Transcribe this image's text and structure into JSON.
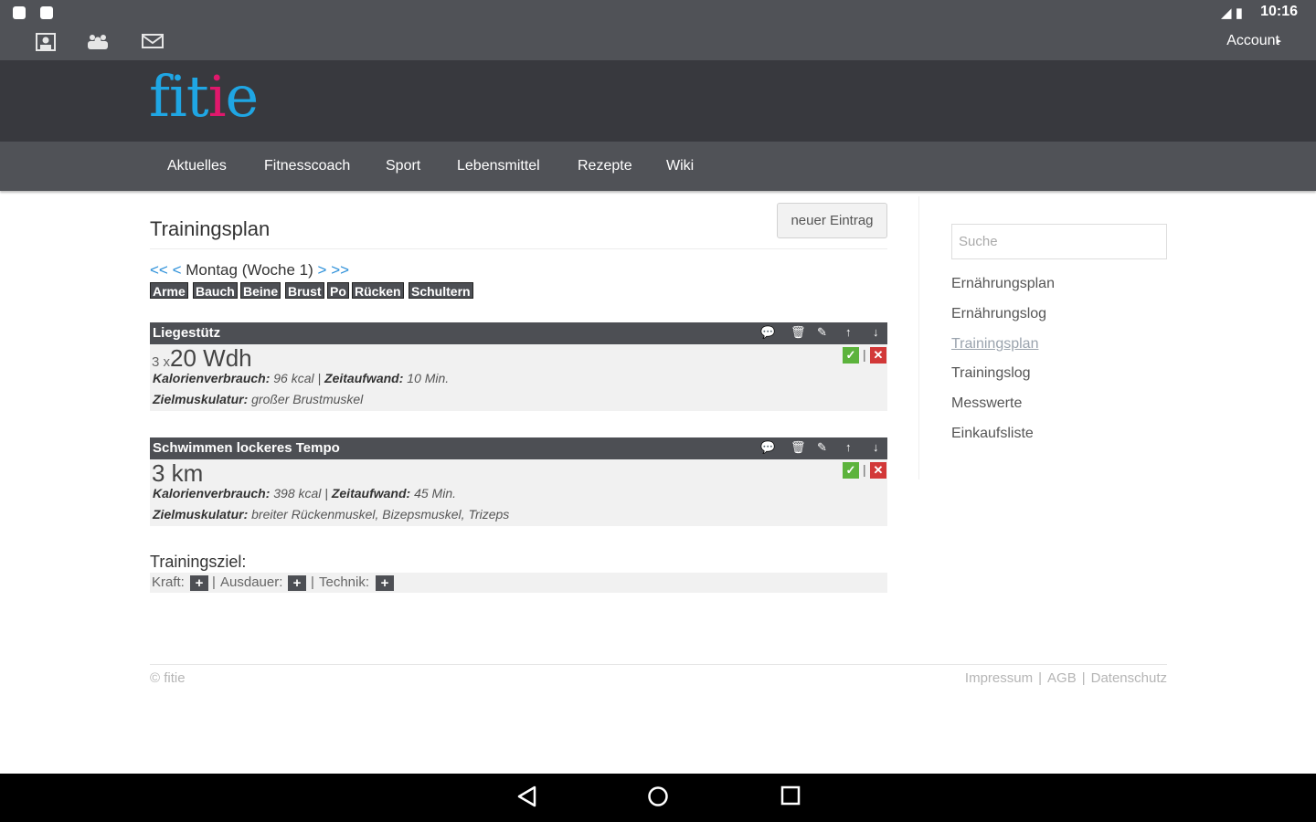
{
  "status_bar": {
    "time": "10:16",
    "account_label": "Account",
    "icons": [
      "notification-icon",
      "notification-icon",
      "signal-icon",
      "battery-icon"
    ]
  },
  "app_bar": {
    "icons": [
      "profile-icon",
      "community-icon",
      "mail-icon"
    ]
  },
  "logo": {
    "part1": "fit",
    "part2": "i",
    "part3": "e",
    "color1": "#1fa6e4",
    "color2": "#e0186c"
  },
  "nav": {
    "items": [
      "Aktuelles",
      "Fitnesscoach",
      "Sport",
      "Lebensmittel",
      "Rezepte",
      "Wiki"
    ]
  },
  "main": {
    "title": "Trainingsplan",
    "new_entry_label": "neuer Eintrag",
    "day_nav": {
      "first": "<<",
      "prev": "<",
      "label": "Montag (Woche 1)",
      "next": ">",
      "last": ">>"
    },
    "tags": [
      "Arme",
      "Bauch",
      "Beine",
      "Brust",
      "Po",
      "Rücken",
      "Schultern"
    ],
    "exercises": [
      {
        "name": "Liegestütz",
        "sets": "3 x",
        "amount": "20 Wdh",
        "kcal_label": "Kalorienverbrauch:",
        "kcal": "96 kcal",
        "time_label": "Zeitaufwand:",
        "time": "10 Min.",
        "muscle_label": "Zielmuskulatur:",
        "muscles": "großer Brustmuskel"
      },
      {
        "name": "Schwimmen lockeres Tempo",
        "sets": "",
        "amount": "3 km",
        "kcal_label": "Kalorienverbrauch:",
        "kcal": "398 kcal",
        "time_label": "Zeitaufwand:",
        "time": "45 Min.",
        "muscle_label": "Zielmuskulatur:",
        "muscles": "breiter Rückenmuskel, Bizepsmuskel, Trizeps"
      }
    ],
    "goal": {
      "title": "Trainingsziel:",
      "items": [
        "Kraft:",
        "Ausdauer:",
        "Technik:"
      ]
    }
  },
  "sidebar": {
    "search_placeholder": "Suche",
    "links": [
      "Ernährungsplan",
      "Ernährungslog",
      "Trainingsplan",
      "Trainingslog",
      "Messwerte",
      "Einkaufsliste"
    ],
    "active_link": "Trainingsplan"
  },
  "footer": {
    "copyright": "© fitie",
    "links": [
      "Impressum",
      "AGB",
      "Datenschutz"
    ]
  }
}
